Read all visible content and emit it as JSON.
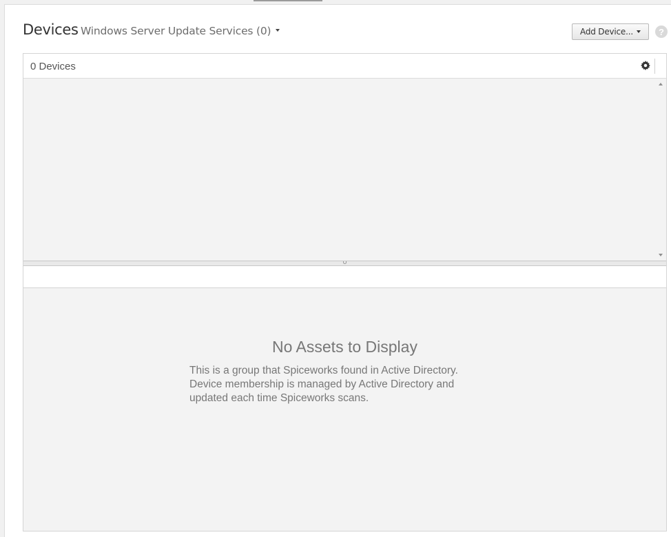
{
  "header": {
    "title": "Devices",
    "group_name": "Windows Server Update Services (0)",
    "add_device_label": "Add Device...",
    "help_symbol": "?"
  },
  "grid": {
    "device_count_label": "0 Devices"
  },
  "empty_state": {
    "title": "No Assets to Display",
    "message": "This is a group that Spiceworks found in Active Directory. Device membership is managed by Active Directory and updated each time Spiceworks scans."
  },
  "icons": {
    "settings": "gear-icon",
    "help": "help-icon",
    "dropdown": "caret-down-icon",
    "scroll_up": "scroll-up-icon",
    "scroll_down": "scroll-down-icon"
  },
  "colors": {
    "panel_background": "#ffffff",
    "page_background": "#f1f1f1",
    "list_background": "#f3f3f3",
    "muted_text": "#777777"
  }
}
